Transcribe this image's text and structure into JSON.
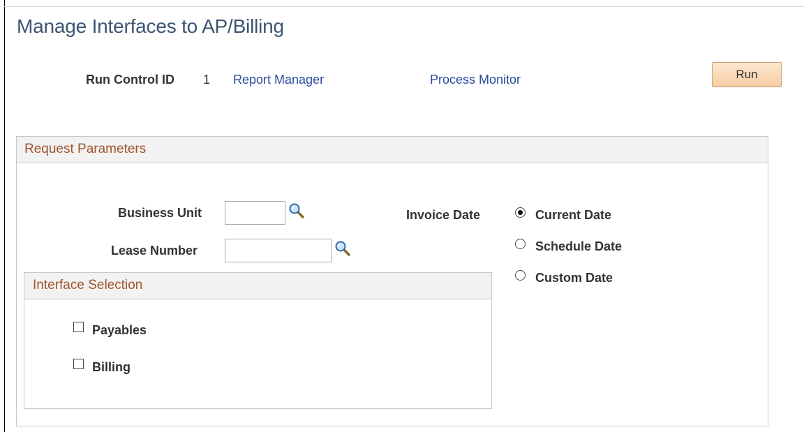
{
  "page": {
    "title": "Manage Interfaces to AP/Billing"
  },
  "run_control": {
    "label": "Run Control ID",
    "value": "1",
    "report_manager_link": "Report Manager",
    "process_monitor_link": "Process Monitor",
    "run_button": "Run"
  },
  "request_parameters": {
    "title": "Request Parameters",
    "business_unit": {
      "label": "Business Unit",
      "value": ""
    },
    "lease_number": {
      "label": "Lease Number",
      "value": ""
    },
    "invoice_date": {
      "label": "Invoice Date",
      "options": [
        "Current Date",
        "Schedule Date",
        "Custom Date"
      ],
      "selected": "Current Date"
    },
    "interface_selection": {
      "title": "Interface Selection",
      "options": [
        {
          "label": "Payables",
          "checked": false
        },
        {
          "label": "Billing",
          "checked": false
        }
      ]
    }
  },
  "icons": {
    "lookup": "magnifying-glass-icon"
  }
}
